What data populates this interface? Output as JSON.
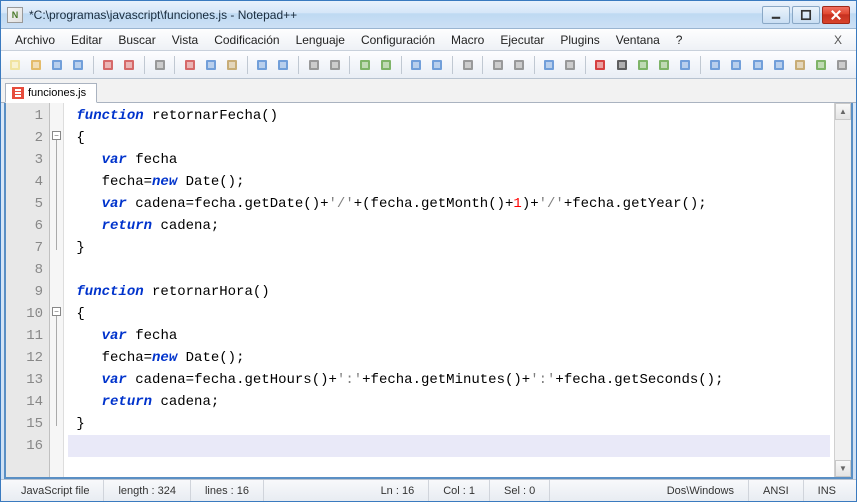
{
  "window": {
    "title": "*C:\\programas\\javascript\\funciones.js - Notepad++"
  },
  "menu": {
    "items": [
      "Archivo",
      "Editar",
      "Buscar",
      "Vista",
      "Codificación",
      "Lenguaje",
      "Configuración",
      "Macro",
      "Ejecutar",
      "Plugins",
      "Ventana",
      "?"
    ]
  },
  "tabs": [
    {
      "label": "funciones.js"
    }
  ],
  "code": {
    "lines": [
      {
        "n": 1,
        "tokens": [
          {
            "t": "kw",
            "v": "function"
          },
          {
            "t": "sp",
            "v": " "
          },
          {
            "t": "id",
            "v": "retornarFecha"
          },
          {
            "t": "op",
            "v": "()"
          }
        ]
      },
      {
        "n": 2,
        "tokens": [
          {
            "t": "op",
            "v": "{"
          }
        ],
        "fold": "minus"
      },
      {
        "n": 3,
        "tokens": [
          {
            "t": "sp",
            "v": "   "
          },
          {
            "t": "kw",
            "v": "var"
          },
          {
            "t": "sp",
            "v": " "
          },
          {
            "t": "id",
            "v": "fecha"
          }
        ]
      },
      {
        "n": 4,
        "tokens": [
          {
            "t": "sp",
            "v": "   "
          },
          {
            "t": "id",
            "v": "fecha"
          },
          {
            "t": "op",
            "v": "="
          },
          {
            "t": "kw",
            "v": "new"
          },
          {
            "t": "sp",
            "v": " "
          },
          {
            "t": "id",
            "v": "Date"
          },
          {
            "t": "op",
            "v": "();"
          }
        ]
      },
      {
        "n": 5,
        "tokens": [
          {
            "t": "sp",
            "v": "   "
          },
          {
            "t": "kw",
            "v": "var"
          },
          {
            "t": "sp",
            "v": " "
          },
          {
            "t": "id",
            "v": "cadena"
          },
          {
            "t": "op",
            "v": "="
          },
          {
            "t": "id",
            "v": "fecha"
          },
          {
            "t": "op",
            "v": "."
          },
          {
            "t": "id",
            "v": "getDate"
          },
          {
            "t": "op",
            "v": "()+"
          },
          {
            "t": "str",
            "v": "'/'"
          },
          {
            "t": "op",
            "v": "+("
          },
          {
            "t": "id",
            "v": "fecha"
          },
          {
            "t": "op",
            "v": "."
          },
          {
            "t": "id",
            "v": "getMonth"
          },
          {
            "t": "op",
            "v": "()+"
          },
          {
            "t": "num",
            "v": "1"
          },
          {
            "t": "op",
            "v": ")+"
          },
          {
            "t": "str",
            "v": "'/'"
          },
          {
            "t": "op",
            "v": "+"
          },
          {
            "t": "id",
            "v": "fecha"
          },
          {
            "t": "op",
            "v": "."
          },
          {
            "t": "id",
            "v": "getYear"
          },
          {
            "t": "op",
            "v": "();"
          }
        ]
      },
      {
        "n": 6,
        "tokens": [
          {
            "t": "sp",
            "v": "   "
          },
          {
            "t": "kw",
            "v": "return"
          },
          {
            "t": "sp",
            "v": " "
          },
          {
            "t": "id",
            "v": "cadena"
          },
          {
            "t": "op",
            "v": ";"
          }
        ]
      },
      {
        "n": 7,
        "tokens": [
          {
            "t": "op",
            "v": "}"
          }
        ]
      },
      {
        "n": 8,
        "tokens": []
      },
      {
        "n": 9,
        "tokens": [
          {
            "t": "kw",
            "v": "function"
          },
          {
            "t": "sp",
            "v": " "
          },
          {
            "t": "id",
            "v": "retornarHora"
          },
          {
            "t": "op",
            "v": "()"
          }
        ]
      },
      {
        "n": 10,
        "tokens": [
          {
            "t": "op",
            "v": "{"
          }
        ],
        "fold": "minus"
      },
      {
        "n": 11,
        "tokens": [
          {
            "t": "sp",
            "v": "   "
          },
          {
            "t": "kw",
            "v": "var"
          },
          {
            "t": "sp",
            "v": " "
          },
          {
            "t": "id",
            "v": "fecha"
          }
        ]
      },
      {
        "n": 12,
        "tokens": [
          {
            "t": "sp",
            "v": "   "
          },
          {
            "t": "id",
            "v": "fecha"
          },
          {
            "t": "op",
            "v": "="
          },
          {
            "t": "kw",
            "v": "new"
          },
          {
            "t": "sp",
            "v": " "
          },
          {
            "t": "id",
            "v": "Date"
          },
          {
            "t": "op",
            "v": "();"
          }
        ]
      },
      {
        "n": 13,
        "tokens": [
          {
            "t": "sp",
            "v": "   "
          },
          {
            "t": "kw",
            "v": "var"
          },
          {
            "t": "sp",
            "v": " "
          },
          {
            "t": "id",
            "v": "cadena"
          },
          {
            "t": "op",
            "v": "="
          },
          {
            "t": "id",
            "v": "fecha"
          },
          {
            "t": "op",
            "v": "."
          },
          {
            "t": "id",
            "v": "getHours"
          },
          {
            "t": "op",
            "v": "()+"
          },
          {
            "t": "str",
            "v": "':'"
          },
          {
            "t": "op",
            "v": "+"
          },
          {
            "t": "id",
            "v": "fecha"
          },
          {
            "t": "op",
            "v": "."
          },
          {
            "t": "id",
            "v": "getMinutes"
          },
          {
            "t": "op",
            "v": "()+"
          },
          {
            "t": "str",
            "v": "':'"
          },
          {
            "t": "op",
            "v": "+"
          },
          {
            "t": "id",
            "v": "fecha"
          },
          {
            "t": "op",
            "v": "."
          },
          {
            "t": "id",
            "v": "getSeconds"
          },
          {
            "t": "op",
            "v": "();"
          }
        ]
      },
      {
        "n": 14,
        "tokens": [
          {
            "t": "sp",
            "v": "   "
          },
          {
            "t": "kw",
            "v": "return"
          },
          {
            "t": "sp",
            "v": " "
          },
          {
            "t": "id",
            "v": "cadena"
          },
          {
            "t": "op",
            "v": ";"
          }
        ]
      },
      {
        "n": 15,
        "tokens": [
          {
            "t": "op",
            "v": "}"
          }
        ]
      },
      {
        "n": 16,
        "tokens": [],
        "highlight": true
      }
    ]
  },
  "status": {
    "filetype": "JavaScript file",
    "length": "length : 324",
    "lines": "lines : 16",
    "ln": "Ln : 16",
    "col": "Col : 1",
    "sel": "Sel : 0",
    "eol": "Dos\\Windows",
    "encoding": "ANSI",
    "mode": "INS"
  },
  "toolbar_icons": [
    "new-file-icon",
    "open-file-icon",
    "save-icon",
    "save-all-icon",
    "sep",
    "close-icon",
    "close-all-icon",
    "sep",
    "print-icon",
    "sep",
    "cut-icon",
    "copy-icon",
    "paste-icon",
    "sep",
    "undo-icon",
    "redo-icon",
    "sep",
    "find-icon",
    "replace-icon",
    "sep",
    "zoom-in-icon",
    "zoom-out-icon",
    "sep",
    "sync-v-icon",
    "sync-h-icon",
    "sep",
    "wrap-icon",
    "sep",
    "all-chars-icon",
    "indent-guide-icon",
    "sep",
    "lang-icon",
    "user-lang-icon",
    "sep",
    "record-icon",
    "stop-icon",
    "play-icon",
    "play-multi-icon",
    "save-macro-icon",
    "sep",
    "function-list-icon",
    "fold-all-icon",
    "unfold-all-icon",
    "collapse-level-icon",
    "doc-map-icon",
    "spell-icon",
    "doc-switcher-icon"
  ]
}
